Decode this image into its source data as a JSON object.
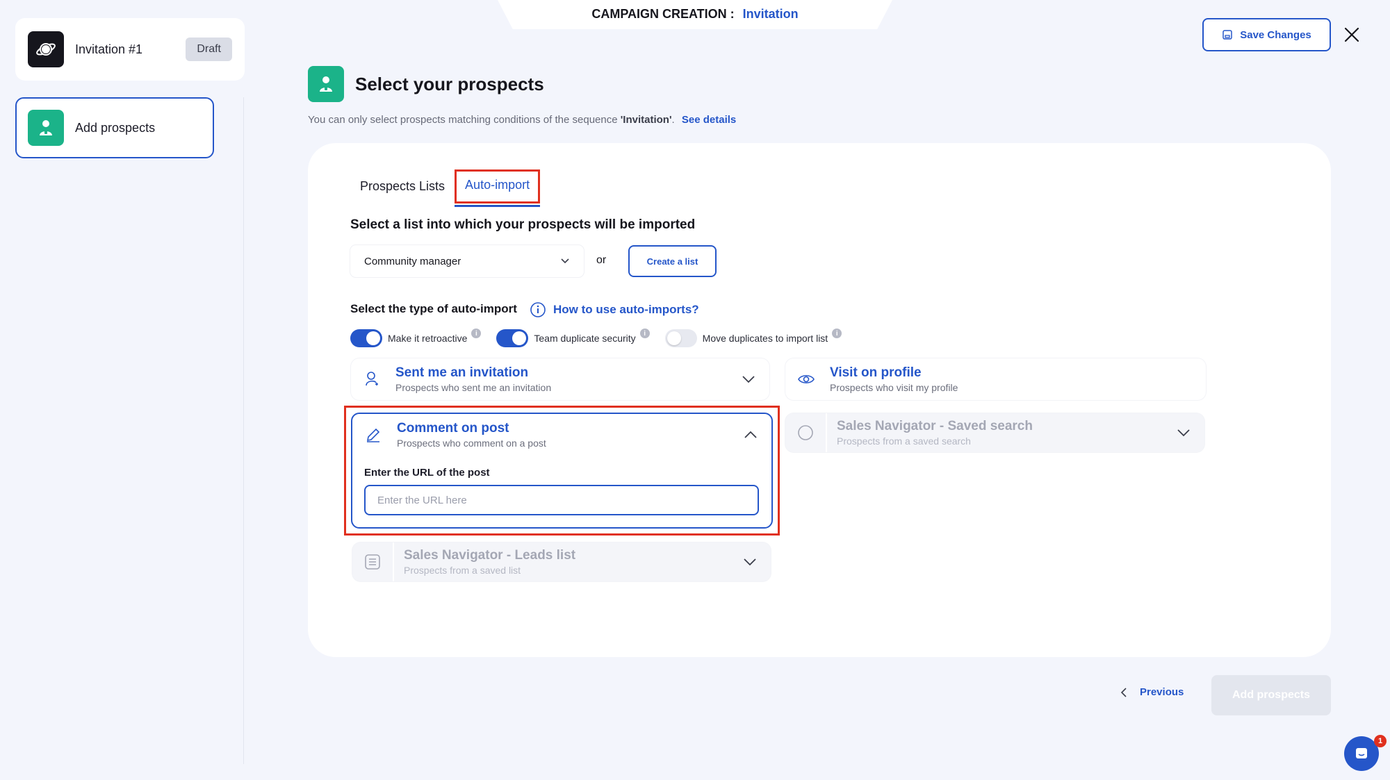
{
  "header": {
    "campaign_prefix": "CAMPAIGN CREATION :",
    "campaign_value": "Invitation",
    "save_label": "Save Changes"
  },
  "sidebar": {
    "campaign_name": "Invitation #1",
    "status_badge": "Draft",
    "step_label": "Add prospects"
  },
  "page": {
    "title": "Select your prospects",
    "subtitle_before": "You can only select prospects matching conditions of the sequence ",
    "subtitle_bold": "'Invitation'",
    "subtitle_after": ".",
    "see_details": "See details"
  },
  "tabs": [
    {
      "label": "Prospects Lists",
      "active": false
    },
    {
      "label": "Auto-import",
      "active": true
    }
  ],
  "import_list": {
    "label": "Select a list into which your prospects will be imported",
    "selected": "Community manager",
    "or": "or",
    "create_label": "Create a list"
  },
  "auto_import": {
    "label": "Select the type of auto-import",
    "help_link": "How to use auto-imports?",
    "toggles": [
      {
        "label": "Make it retroactive",
        "on": true
      },
      {
        "label": "Team duplicate security",
        "on": true
      },
      {
        "label": "Move duplicates to import list",
        "on": false
      }
    ],
    "options": {
      "invitation": {
        "title": "Sent me an invitation",
        "desc": "Prospects who sent me an invitation",
        "icon": "user-plus-icon"
      },
      "visit": {
        "title": "Visit on profile",
        "desc": "Prospects who visit my profile",
        "icon": "eye-icon"
      },
      "comment": {
        "title": "Comment on post",
        "desc": "Prospects who comment on a post",
        "icon": "pencil-icon",
        "url_label": "Enter the URL of the post",
        "url_placeholder": "Enter the URL here"
      },
      "saved_search": {
        "title": "Sales Navigator - Saved search",
        "desc": "Prospects from a saved search",
        "icon": "search-icon"
      },
      "leads_list": {
        "title": "Sales Navigator - Leads list",
        "desc": "Prospects from a saved list",
        "icon": "list-icon"
      }
    }
  },
  "footer": {
    "previous": "Previous",
    "add": "Add prospects",
    "chat_count": "1"
  },
  "colors": {
    "accent": "#2556c9",
    "green": "#1bb389",
    "highlight": "#e0301e"
  }
}
